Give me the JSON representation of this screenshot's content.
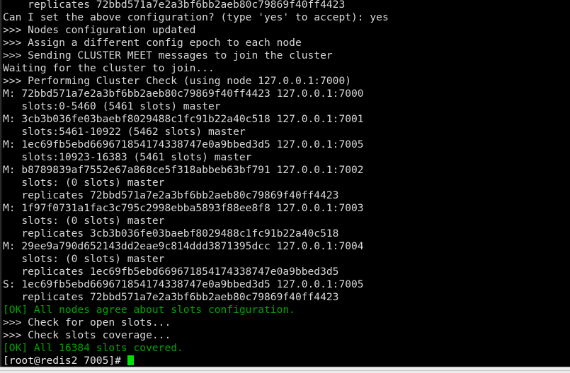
{
  "window": {
    "title": "root@redis2:~",
    "kind": "terminal-emulator",
    "colors": {
      "background": "#000000",
      "foreground": "#d8d8d8",
      "ok_green": "#00a400",
      "cursor_green": "#00e000",
      "chrome": "#ececec",
      "frame": "#2b2b2b"
    }
  },
  "terminal": {
    "rows": 29,
    "cols": 84,
    "cursor": {
      "visible": true,
      "shape": "block",
      "color": "#00e000"
    },
    "prompt": {
      "user": "root",
      "host": "redis2",
      "cwd": "7005",
      "symbol": "#",
      "text": "[root@redis2 7005]# "
    },
    "lines": [
      {
        "style": "normal",
        "text": "    replicates 72bbd571a7e2a3bf6bb2aeb80c79869f40ff4423"
      },
      {
        "style": "normal",
        "text": "Can I set the above configuration? (type 'yes' to accept): yes"
      },
      {
        "style": "normal",
        "text": ">>> Nodes configuration updated"
      },
      {
        "style": "normal",
        "text": ">>> Assign a different config epoch to each node"
      },
      {
        "style": "normal",
        "text": ">>> Sending CLUSTER MEET messages to join the cluster"
      },
      {
        "style": "normal",
        "text": "Waiting for the cluster to join..."
      },
      {
        "style": "normal",
        "text": ">>> Performing Cluster Check (using node 127.0.0.1:7000)"
      },
      {
        "style": "normal",
        "text": "M: 72bbd571a7e2a3bf6bb2aeb80c79869f40ff4423 127.0.0.1:7000"
      },
      {
        "style": "normal",
        "text": "   slots:0-5460 (5461 slots) master"
      },
      {
        "style": "normal",
        "text": "M: 3cb3b036fe03baebf8029488c1fc91b22a40c518 127.0.0.1:7001"
      },
      {
        "style": "normal",
        "text": "   slots:5461-10922 (5462 slots) master"
      },
      {
        "style": "normal",
        "text": "M: 1ec69fb5ebd669671854174338747e0a9bbed3d5 127.0.0.1:7005"
      },
      {
        "style": "normal",
        "text": "   slots:10923-16383 (5461 slots) master"
      },
      {
        "style": "normal",
        "text": "M: b8789839af7552e67a868ce5f318abbeb63bf791 127.0.0.1:7002"
      },
      {
        "style": "normal",
        "text": "   slots: (0 slots) master"
      },
      {
        "style": "normal",
        "text": "   replicates 72bbd571a7e2a3bf6bb2aeb80c79869f40ff4423"
      },
      {
        "style": "normal",
        "text": "M: 1f97f0731a1fac3c795c2998ebba5893f88ee8f8 127.0.0.1:7003"
      },
      {
        "style": "normal",
        "text": "   slots: (0 slots) master"
      },
      {
        "style": "normal",
        "text": "   replicates 3cb3b036fe03baebf8029488c1fc91b22a40c518"
      },
      {
        "style": "normal",
        "text": "M: 29ee9a790d652143dd2eae9c814ddd3871395dcc 127.0.0.1:7004"
      },
      {
        "style": "normal",
        "text": "   slots: (0 slots) master"
      },
      {
        "style": "normal",
        "text": "   replicates 1ec69fb5ebd669671854174338747e0a9bbed3d5"
      },
      {
        "style": "normal",
        "text": "S: 1ec69fb5ebd669671854174338747e0a9bbed3d5 127.0.0.1:7005"
      },
      {
        "style": "normal",
        "text": "   replicates 72bbd571a7e2a3bf6bb2aeb80c79869f40ff4423"
      },
      {
        "style": "ok",
        "text": "[OK] All nodes agree about slots configuration."
      },
      {
        "style": "normal",
        "text": ">>> Check for open slots..."
      },
      {
        "style": "normal",
        "text": ">>> Check slots coverage..."
      },
      {
        "style": "ok",
        "text": "[OK] All 16384 slots covered."
      }
    ]
  }
}
